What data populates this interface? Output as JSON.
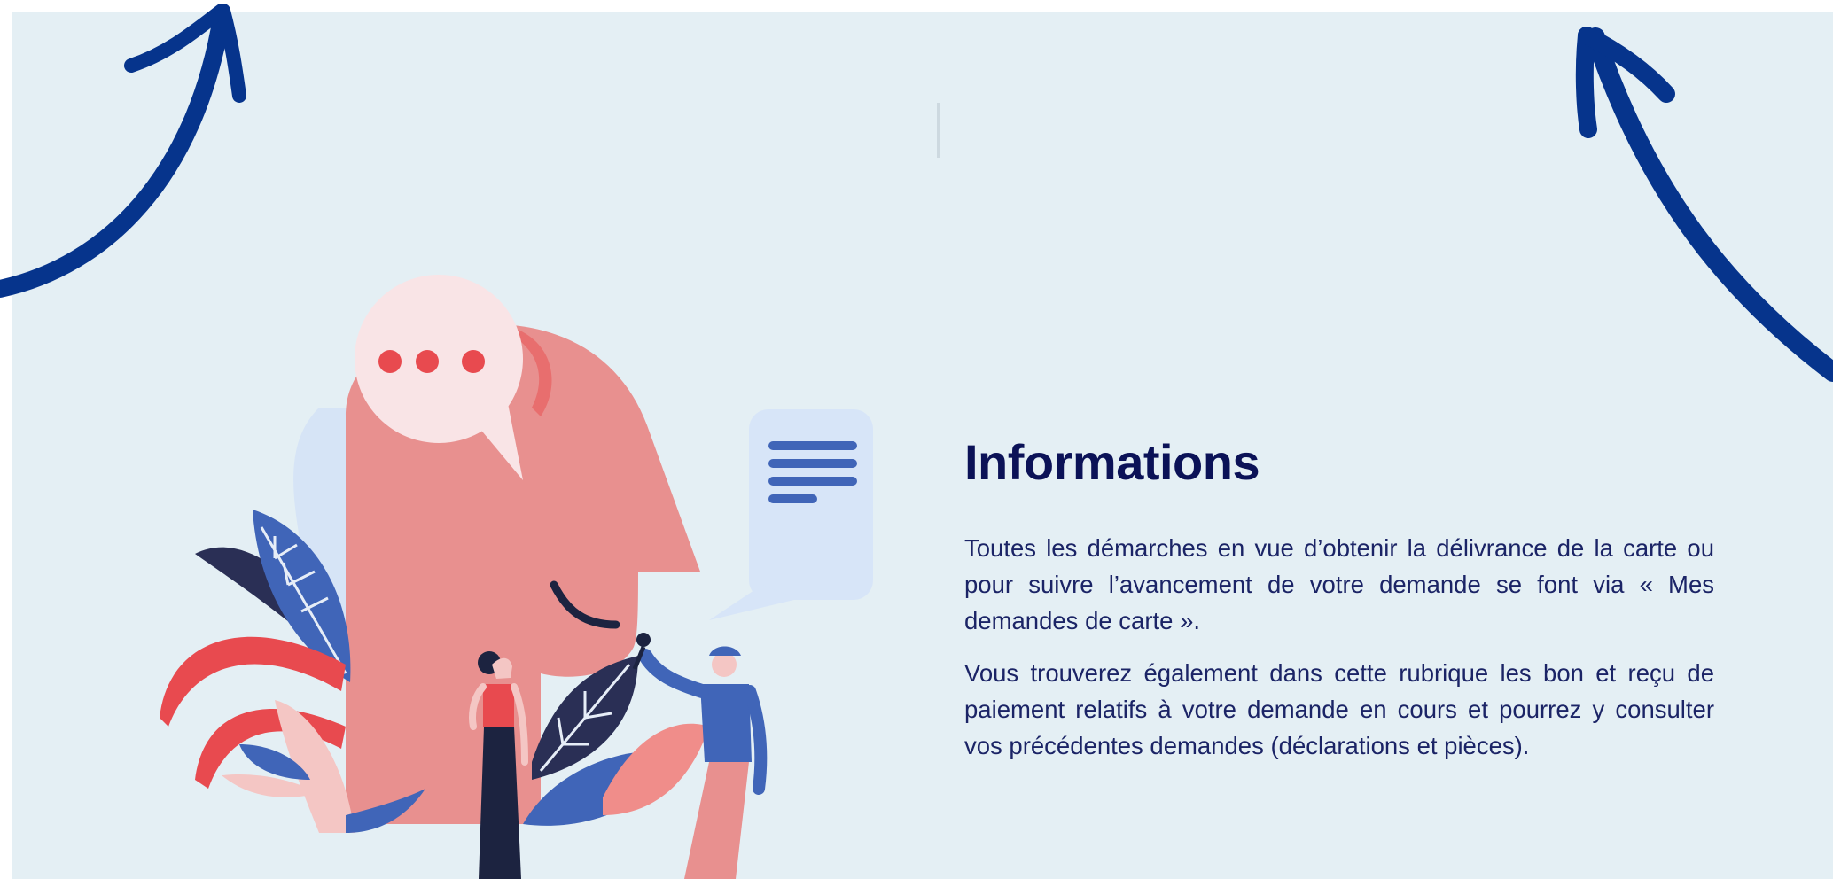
{
  "colors": {
    "background": "#e4eff4",
    "title": "#0b1257",
    "text": "#1b2466",
    "arrow": "#06348c",
    "head": "#e8908f",
    "bubble": "#f9e4e6",
    "accent_red": "#e84a4f",
    "accent_blue": "#4065b8",
    "document_bubble": "#d7e5f8"
  },
  "icons": {
    "arrow_left": "curved-arrow-up-icon",
    "arrow_right": "curved-arrow-up-icon",
    "speech_bubble": "speech-bubble-dots-icon",
    "document_bubble": "document-lines-icon"
  },
  "info": {
    "title": "Informations",
    "paragraphs": [
      "Toutes les démarches en vue d’obtenir la délivrance de la carte ou pour suivre l’avancement de votre demande se font via « Mes demandes de carte ».",
      "Vous trouverez également dans cette rubrique les bon et reçu de paiement relatifs à votre demande en cours et pourrez y consulter vos précédentes demandes (déclarations et pièces)."
    ]
  }
}
